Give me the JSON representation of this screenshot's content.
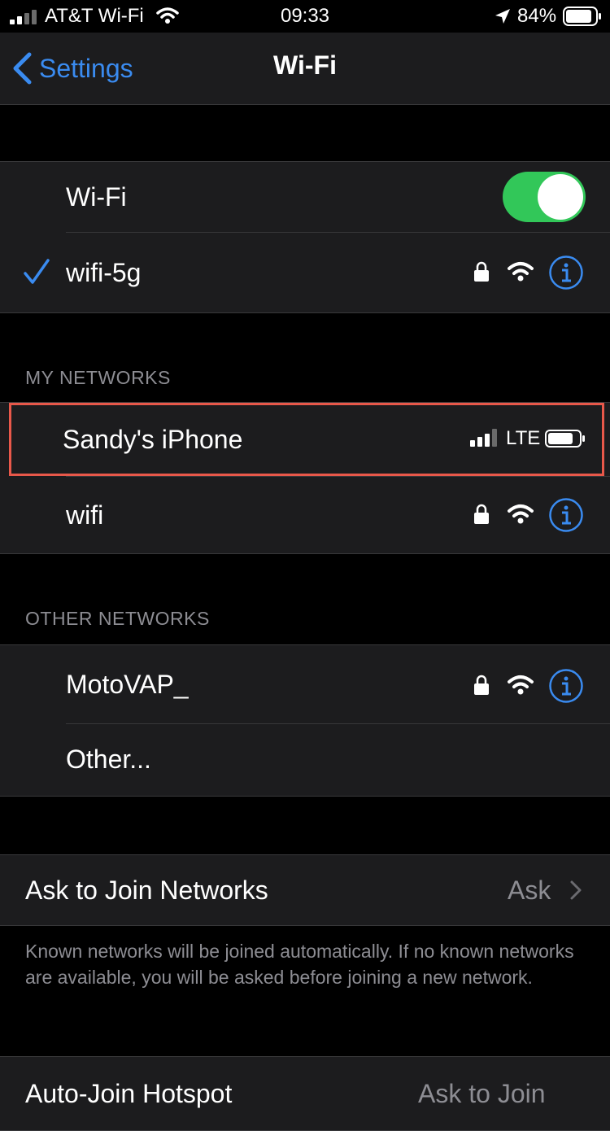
{
  "status_bar": {
    "carrier": "AT&T Wi-Fi",
    "time": "09:33",
    "battery_percent": "84%"
  },
  "nav": {
    "back_label": "Settings",
    "title": "Wi-Fi"
  },
  "wifi_group": {
    "toggle_label": "Wi-Fi",
    "toggle_on": true,
    "connected_network": "wifi-5g"
  },
  "my_networks": {
    "header": "MY NETWORKS",
    "items": [
      {
        "name": "Sandy's iPhone",
        "network_type": "LTE"
      },
      {
        "name": "wifi"
      }
    ]
  },
  "other_networks": {
    "header": "OTHER NETWORKS",
    "items": [
      {
        "name": "MotoVAP_"
      },
      {
        "name": "Other..."
      }
    ]
  },
  "ask_to_join": {
    "label": "Ask to Join Networks",
    "value": "Ask",
    "description": "Known networks will be joined automatically. If no known networks are available, you will be asked before joining a new network."
  },
  "auto_join_hotspot": {
    "label": "Auto-Join Hotspot",
    "value": "Ask to Join"
  },
  "colors": {
    "accent": "#3a8bf0",
    "toggle_on": "#32c759",
    "highlight_border": "#e8584a",
    "cell_bg": "#1c1c1e",
    "secondary_text": "#8d8d93"
  }
}
